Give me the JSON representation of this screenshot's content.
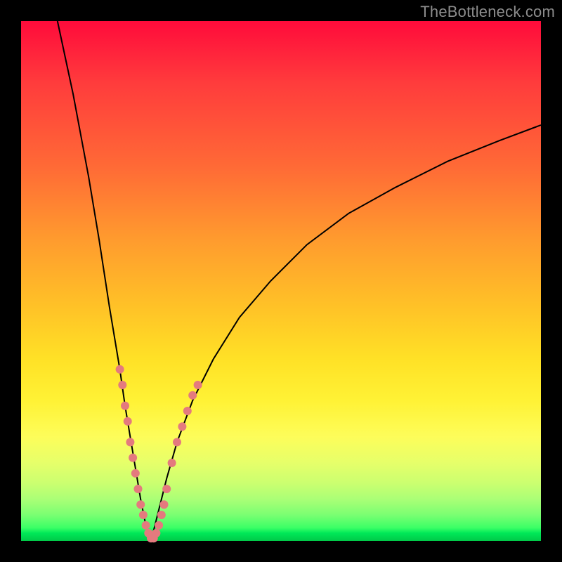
{
  "watermark": "TheBottleneck.com",
  "colors": {
    "frame": "#000000",
    "curve": "#000000",
    "dot": "#e47a7e",
    "gradient_top": "#ff0b3b",
    "gradient_bottom": "#00c948",
    "watermark_text": "#8c8c8c"
  },
  "chart_data": {
    "type": "line",
    "title": "",
    "xlabel": "",
    "ylabel": "",
    "xlim": [
      0,
      100
    ],
    "ylim": [
      0,
      100
    ],
    "axes_visible": false,
    "background": "vertical gradient red→orange→yellow→green (bottleneck heat scale)",
    "note": "Two curves descending into a V near x≈25. Left branch enters from top-left and plunges nearly vertically to the valley at y≈0. Right branch rises from the same valley and arcs toward the upper-right, flattening around y≈80 at the right edge. Pink dots cluster on both branches near the valley.",
    "series": [
      {
        "name": "left-branch",
        "x": [
          7,
          10,
          13,
          15,
          17,
          19,
          20,
          21,
          22,
          23,
          24,
          25
        ],
        "y": [
          100,
          86,
          70,
          58,
          45,
          33,
          26,
          20,
          14,
          8,
          3,
          0
        ]
      },
      {
        "name": "right-branch",
        "x": [
          25,
          26,
          27,
          28,
          30,
          33,
          37,
          42,
          48,
          55,
          63,
          72,
          82,
          92,
          100
        ],
        "y": [
          0,
          4,
          8,
          12,
          19,
          27,
          35,
          43,
          50,
          57,
          63,
          68,
          73,
          77,
          80
        ]
      }
    ],
    "scatter": {
      "name": "highlight-dots",
      "color": "#e47a7e",
      "radius_px": 6,
      "points": [
        {
          "x": 19.0,
          "y": 33
        },
        {
          "x": 19.5,
          "y": 30
        },
        {
          "x": 20.0,
          "y": 26
        },
        {
          "x": 20.5,
          "y": 23
        },
        {
          "x": 21.0,
          "y": 19
        },
        {
          "x": 21.5,
          "y": 16
        },
        {
          "x": 22.0,
          "y": 13
        },
        {
          "x": 22.5,
          "y": 10
        },
        {
          "x": 23.0,
          "y": 7
        },
        {
          "x": 23.5,
          "y": 5
        },
        {
          "x": 24.0,
          "y": 3
        },
        {
          "x": 24.5,
          "y": 1.5
        },
        {
          "x": 25.0,
          "y": 0.5
        },
        {
          "x": 25.5,
          "y": 0.5
        },
        {
          "x": 26.0,
          "y": 1.5
        },
        {
          "x": 26.5,
          "y": 3
        },
        {
          "x": 27.0,
          "y": 5
        },
        {
          "x": 27.5,
          "y": 7
        },
        {
          "x": 28.0,
          "y": 10
        },
        {
          "x": 29.0,
          "y": 15
        },
        {
          "x": 30.0,
          "y": 19
        },
        {
          "x": 31.0,
          "y": 22
        },
        {
          "x": 32.0,
          "y": 25
        },
        {
          "x": 33.0,
          "y": 28
        },
        {
          "x": 34.0,
          "y": 30
        }
      ]
    }
  }
}
